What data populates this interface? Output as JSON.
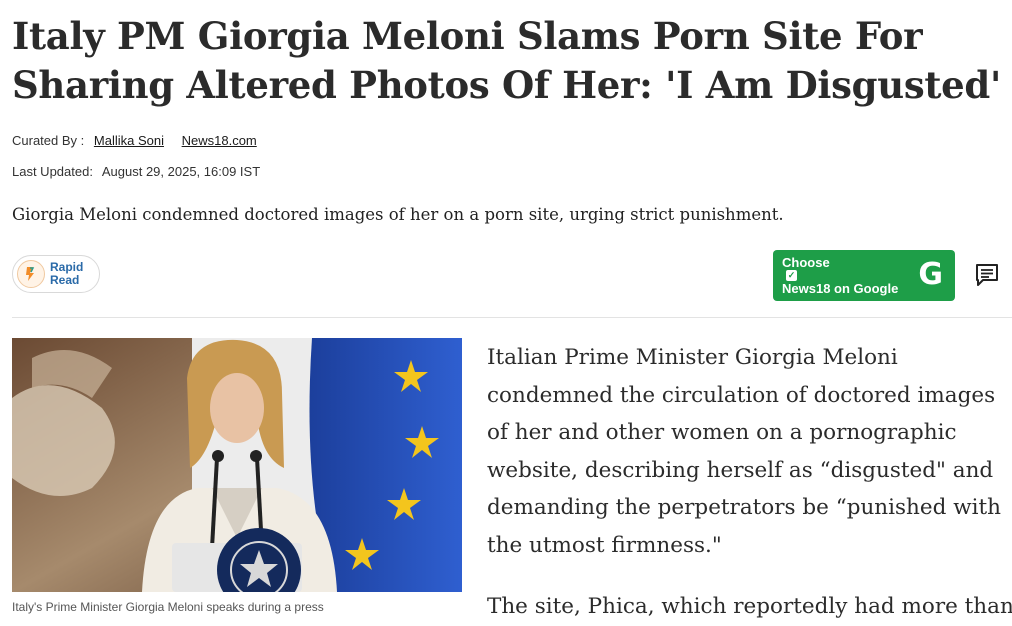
{
  "article": {
    "headline": "Italy PM Giorgia Meloni Slams Porn Site For Sharing Altered Photos Of Her: 'I Am Disgusted'",
    "curated_by_label": "Curated By :",
    "curator": "Mallika Soni",
    "source": "News18.com",
    "last_updated_label": "Last Updated:",
    "last_updated": "August 29, 2025, 16:09 IST",
    "summary": "Giorgia Meloni condemned doctored images of her on a porn site, urging strict punishment.",
    "image_caption": "Italy's Prime Minister Giorgia Meloni speaks during a press",
    "paragraph1": "Italian Prime Minister Giorgia Meloni condemned the circulation of doctored images of her and other women on a pornographic website, describing herself as “disgusted\" and demanding the perpetrators be “punished with the utmost firmness.\"",
    "paragraph2": "The site, Phica, which reportedly had more than"
  },
  "rapid_read": {
    "line1": "Rapid",
    "line2": "Read"
  },
  "google_button": {
    "line1": "Choose",
    "line2": "News18 on Google",
    "logo": "G",
    "icon": "google-g-icon"
  },
  "icons": {
    "comment": "comment-icon",
    "rapid": "lightning-icon"
  },
  "colors": {
    "accent_green": "#1e9e48",
    "rapid_blue": "#2a6aa8"
  }
}
